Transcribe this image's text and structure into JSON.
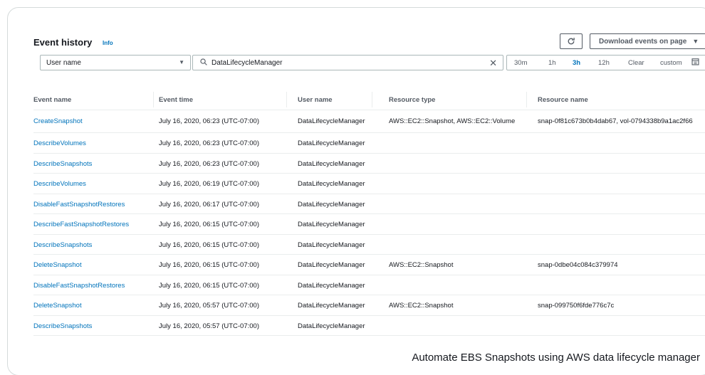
{
  "header": {
    "title": "Event history",
    "info_label": "Info",
    "refresh_icon": "refresh-icon",
    "download_label": "Download events on page"
  },
  "filter": {
    "attribute_value": "User name",
    "search_value": "DataLifecycleManager",
    "time_ranges": [
      "30m",
      "1h",
      "3h",
      "12h"
    ],
    "selected_range": "3h",
    "clear_label": "Clear",
    "custom_label": "custom"
  },
  "table": {
    "columns": [
      "Event name",
      "Event time",
      "User name",
      "Resource type",
      "Resource name"
    ],
    "rows": [
      [
        "CreateSnapshot",
        "July 16, 2020, 06:23 (UTC-07:00)",
        "DataLifecycleManager",
        "AWS::EC2::Snapshot, AWS::EC2::Volume",
        "snap-0f81c673b0b4dab67, vol-0794338b9a1ac2f66"
      ],
      [
        "DescribeVolumes",
        "July 16, 2020, 06:23 (UTC-07:00)",
        "DataLifecycleManager",
        "",
        ""
      ],
      [
        "DescribeSnapshots",
        "July 16, 2020, 06:23 (UTC-07:00)",
        "DataLifecycleManager",
        "",
        ""
      ],
      [
        "DescribeVolumes",
        "July 16, 2020, 06:19 (UTC-07:00)",
        "DataLifecycleManager",
        "",
        ""
      ],
      [
        "DisableFastSnapshotRestores",
        "July 16, 2020, 06:17 (UTC-07:00)",
        "DataLifecycleManager",
        "",
        ""
      ],
      [
        "DescribeFastSnapshotRestores",
        "July 16, 2020, 06:15 (UTC-07:00)",
        "DataLifecycleManager",
        "",
        ""
      ],
      [
        "DescribeSnapshots",
        "July 16, 2020, 06:15 (UTC-07:00)",
        "DataLifecycleManager",
        "",
        ""
      ],
      [
        "DeleteSnapshot",
        "July 16, 2020, 06:15 (UTC-07:00)",
        "DataLifecycleManager",
        "AWS::EC2::Snapshot",
        "snap-0dbe04c084c379974"
      ],
      [
        "DisableFastSnapshotRestores",
        "July 16, 2020, 06:15 (UTC-07:00)",
        "DataLifecycleManager",
        "",
        ""
      ],
      [
        "DeleteSnapshot",
        "July 16, 2020, 05:57 (UTC-07:00)",
        "DataLifecycleManager",
        "AWS::EC2::Snapshot",
        "snap-099750f6fde776c7c"
      ],
      [
        "DescribeSnapshots",
        "July 16, 2020, 05:57 (UTC-07:00)",
        "DataLifecycleManager",
        "",
        ""
      ]
    ]
  },
  "caption": "Automate EBS Snapshots using AWS data lifecycle manager",
  "colors": {
    "link": "#0073bb",
    "text": "#16191f",
    "muted": "#545b64",
    "border": "#aab7b8"
  }
}
